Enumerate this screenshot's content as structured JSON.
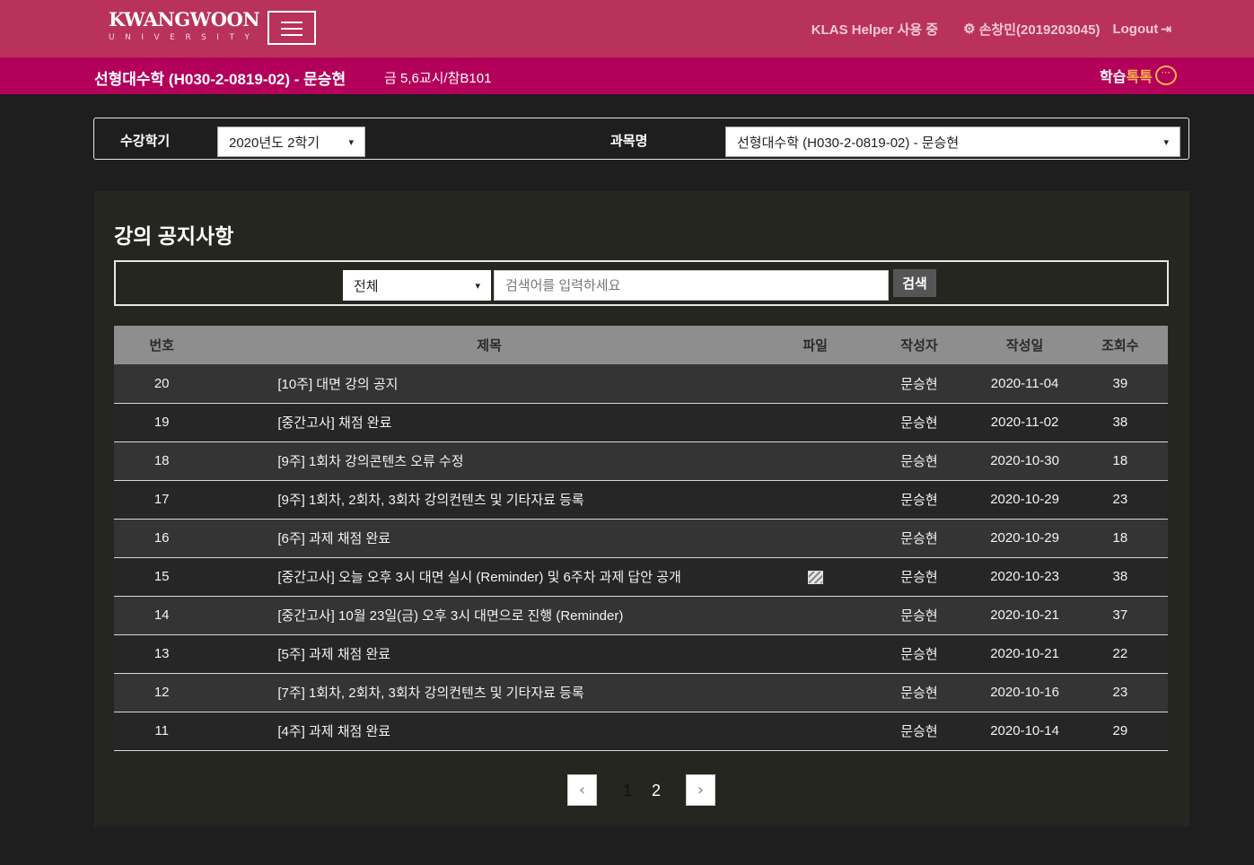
{
  "header": {
    "logo_main": "KWANGWOON",
    "logo_sub": "UNIVERSITY",
    "helper_text": "KLAS Helper 사용 중",
    "user_text": "손창민(2019203045)",
    "logout_label": "Logout",
    "icons": {
      "menu": "hamburger-icon",
      "user": "gear-icon",
      "logout": "logout-icon"
    },
    "colors": {
      "topbar": "#b8325c",
      "subbar": "#b3005a"
    }
  },
  "course_bar": {
    "course_title": "선형대수학 (H030-2-0819-02) - 문승현",
    "time_room": "금 5,6교시/참B101",
    "talk_left": "학습",
    "talk_right": "톡톡"
  },
  "selectors": {
    "semester_label": "수강학기",
    "semester_value": "2020년도 2학기",
    "subject_label": "과목명",
    "subject_value": "선형대수학 (H030-2-0819-02) - 문승현"
  },
  "notice": {
    "title": "강의 공지사항",
    "search": {
      "filter_value": "전체",
      "placeholder": "검색어를 입력하세요",
      "button_label": "검색"
    },
    "columns": [
      "번호",
      "제목",
      "파일",
      "작성자",
      "작성일",
      "조회수"
    ],
    "rows": [
      {
        "no": "20",
        "title": "[10주] 대면 강의 공지",
        "file": false,
        "author": "문승현",
        "date": "2020-11-04",
        "views": "39"
      },
      {
        "no": "19",
        "title": "[중간고사] 채점 완료",
        "file": false,
        "author": "문승현",
        "date": "2020-11-02",
        "views": "38"
      },
      {
        "no": "18",
        "title": "[9주] 1회차 강의콘텐츠 오류 수정",
        "file": false,
        "author": "문승현",
        "date": "2020-10-30",
        "views": "18"
      },
      {
        "no": "17",
        "title": "[9주] 1회차, 2회차, 3회차 강의컨텐츠 및 기타자료 등록",
        "file": false,
        "author": "문승현",
        "date": "2020-10-29",
        "views": "23"
      },
      {
        "no": "16",
        "title": "[6주] 과제 채점 완료",
        "file": false,
        "author": "문승현",
        "date": "2020-10-29",
        "views": "18"
      },
      {
        "no": "15",
        "title": "[중간고사] 오늘 오후 3시 대면 실시 (Reminder) 및 6주차 과제 답안 공개",
        "file": true,
        "author": "문승현",
        "date": "2020-10-23",
        "views": "38"
      },
      {
        "no": "14",
        "title": "[중간고사] 10월 23일(금) 오후 3시 대면으로 진행 (Reminder)",
        "file": false,
        "author": "문승현",
        "date": "2020-10-21",
        "views": "37"
      },
      {
        "no": "13",
        "title": "[5주] 과제 채점 완료",
        "file": false,
        "author": "문승현",
        "date": "2020-10-21",
        "views": "22"
      },
      {
        "no": "12",
        "title": "[7주] 1회차, 2회차, 3회차 강의컨텐츠 및 기타자료 등록",
        "file": false,
        "author": "문승현",
        "date": "2020-10-16",
        "views": "23"
      },
      {
        "no": "11",
        "title": "[4주] 과제 채점 완료",
        "file": false,
        "author": "문승현",
        "date": "2020-10-14",
        "views": "29"
      }
    ],
    "pagination": {
      "pages": [
        "1",
        "2"
      ],
      "current": "1"
    }
  }
}
